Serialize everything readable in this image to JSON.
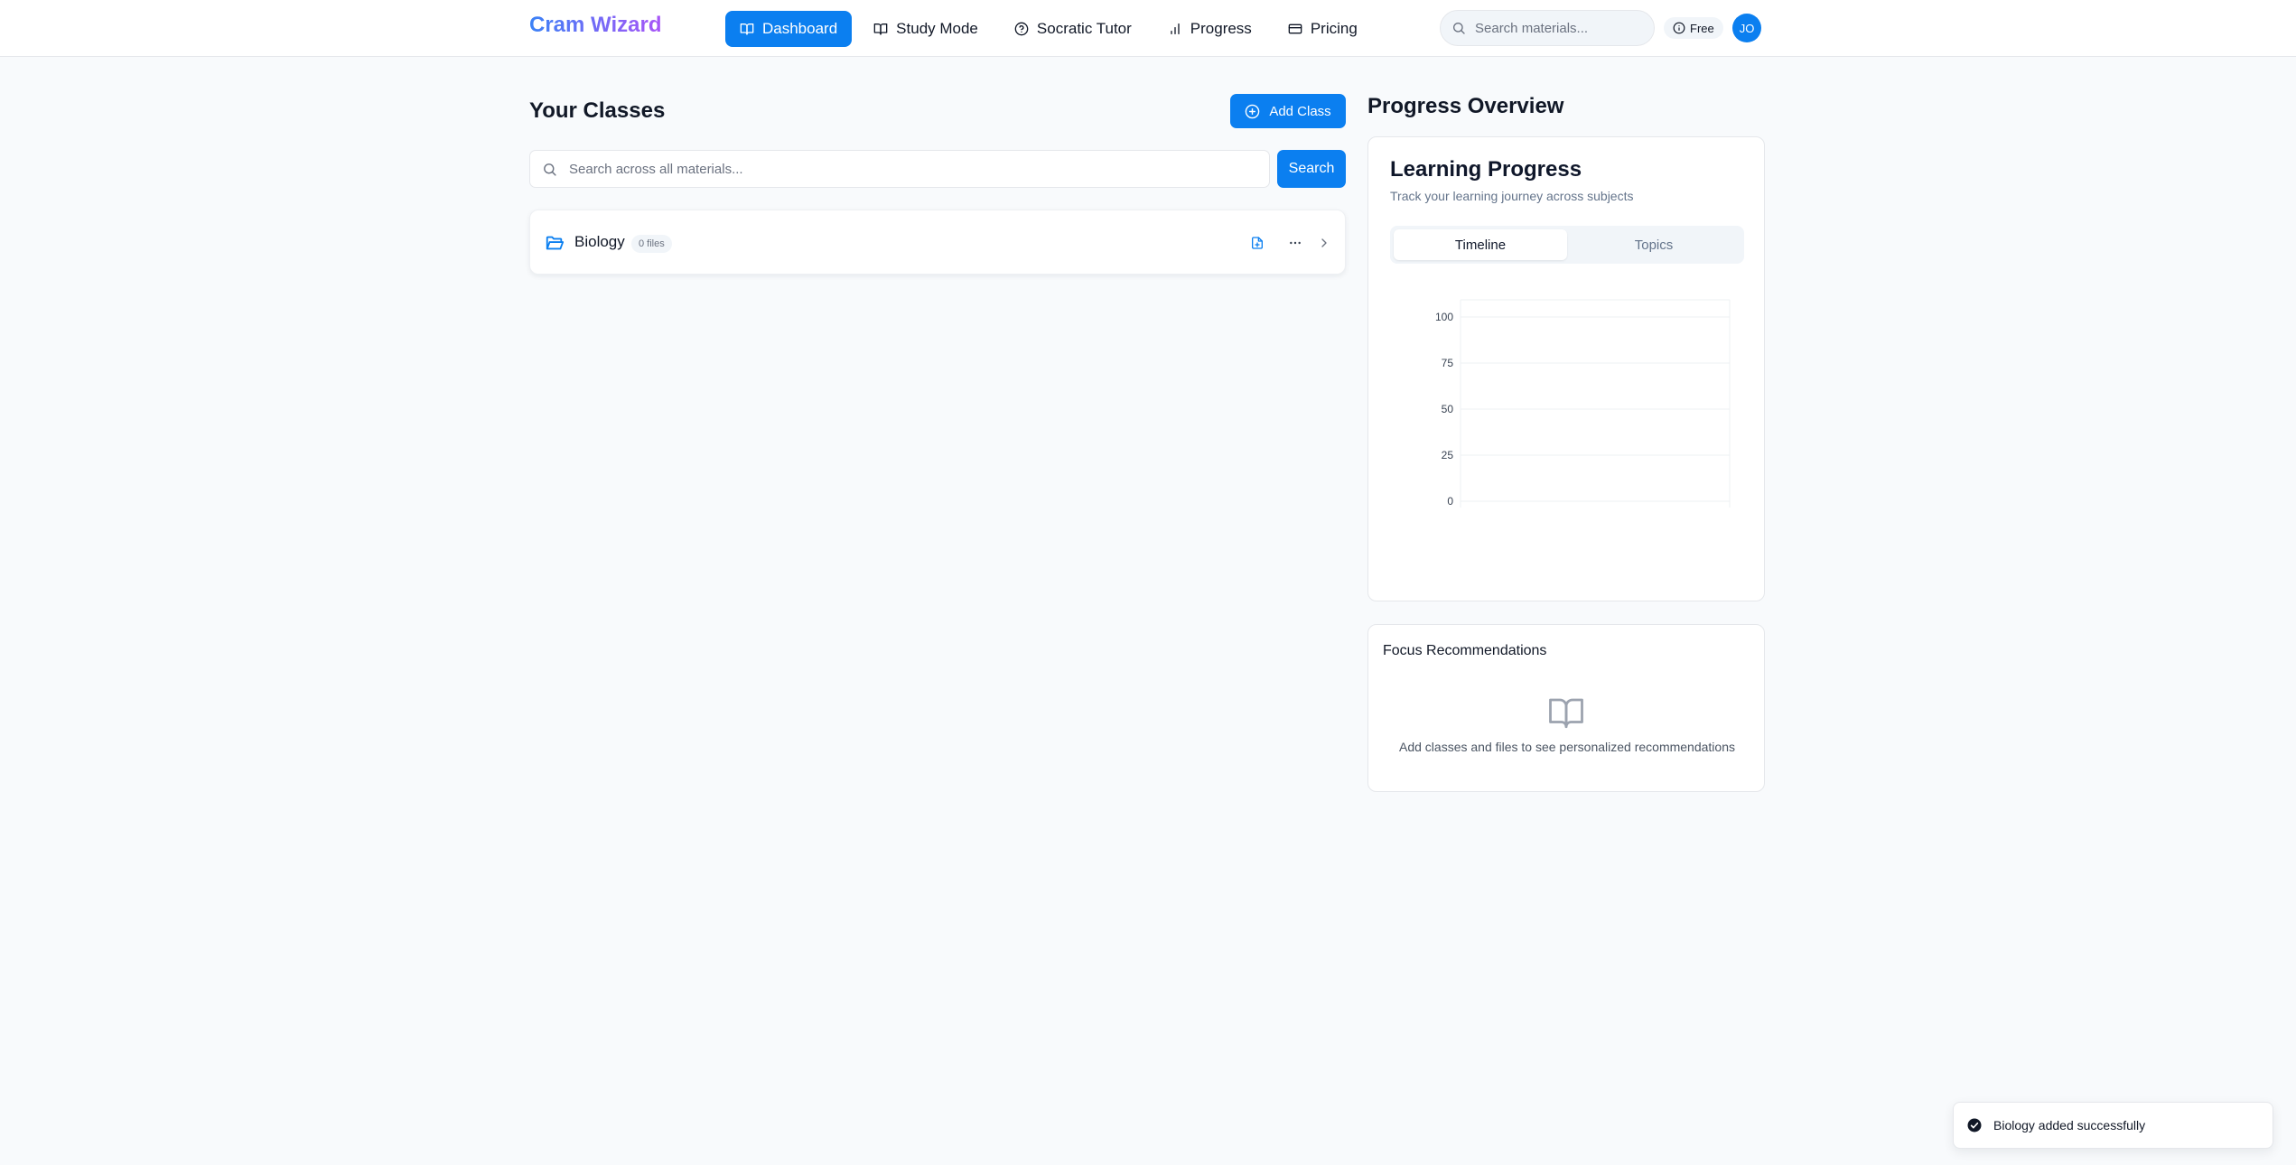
{
  "app": {
    "brand": "Cram Wizard"
  },
  "nav": {
    "items": [
      {
        "label": "Dashboard",
        "icon": "book-open-icon",
        "active": true
      },
      {
        "label": "Study Mode",
        "icon": "book-open-icon"
      },
      {
        "label": "Socratic Tutor",
        "icon": "help-circle-icon"
      },
      {
        "label": "Progress",
        "icon": "bar-chart-icon"
      },
      {
        "label": "Pricing",
        "icon": "credit-card-icon"
      }
    ]
  },
  "header": {
    "search_placeholder": "Search materials...",
    "plan_label": "Free",
    "avatar_initials": "JO"
  },
  "classes": {
    "title": "Your Classes",
    "add_label": "Add Class",
    "search_placeholder": "Search across all materials...",
    "search_button": "Search",
    "items": [
      {
        "name": "Biology",
        "files_label": "0 files"
      }
    ]
  },
  "progress": {
    "section_title": "Progress Overview",
    "card_title": "Learning Progress",
    "card_subtitle": "Track your learning journey across subjects",
    "tabs": [
      {
        "label": "Timeline",
        "active": true
      },
      {
        "label": "Topics"
      }
    ]
  },
  "chart_data": {
    "type": "line",
    "title": "",
    "xlabel": "",
    "ylabel": "",
    "ylim": [
      0,
      100
    ],
    "yticks": [
      100,
      75,
      50,
      25,
      0
    ],
    "x": [],
    "series": [],
    "grid": true
  },
  "focus": {
    "title": "Focus Recommendations",
    "empty_text": "Add classes and files to see personalized recommendations"
  },
  "toast": {
    "message": "Biology added successfully"
  },
  "colors": {
    "accent": "#0b7ff0",
    "brand_start": "#3b82f6",
    "brand_end": "#a855f7"
  }
}
